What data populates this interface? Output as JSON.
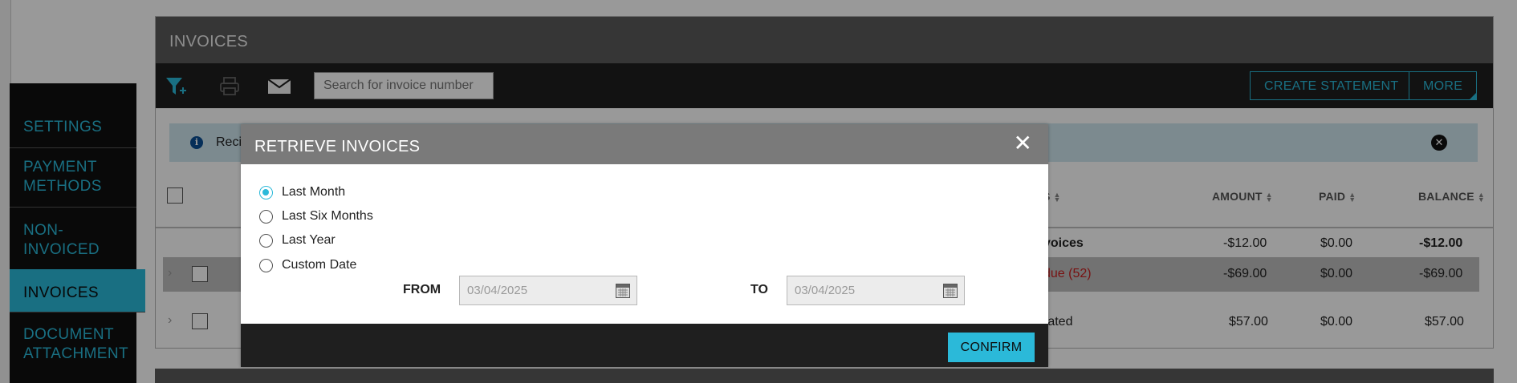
{
  "sidebar": {
    "items": [
      {
        "label": "SETTINGS"
      },
      {
        "label": "PAYMENT METHODS"
      },
      {
        "label": "NON-INVOICED"
      },
      {
        "label": "INVOICES"
      },
      {
        "label": "DOCUMENT ATTACHMENT"
      }
    ]
  },
  "panel": {
    "title": "INVOICES",
    "search_placeholder": "Search for invoice number",
    "create_statement_label": "CREATE STATEMENT",
    "more_label": "MORE",
    "info_text": "Recip"
  },
  "table": {
    "headers": {
      "status": "S",
      "amount": "AMOUNT",
      "paid": "PAID",
      "balance": "BALANCE"
    },
    "rows": [
      {
        "status": "voices",
        "amount": "-$12.00",
        "paid": "$0.00",
        "balance": "-$12.00"
      },
      {
        "status": "due (52)",
        "amount": "-$69.00",
        "paid": "$0.00",
        "balance": "-$69.00"
      },
      {
        "status": "rated",
        "amount": "$57.00",
        "paid": "$0.00",
        "balance": "$57.00"
      }
    ]
  },
  "modal": {
    "title": "RETRIEVE INVOICES",
    "options": [
      {
        "label": "Last Month",
        "selected": true
      },
      {
        "label": "Last Six Months",
        "selected": false
      },
      {
        "label": "Last Year",
        "selected": false
      },
      {
        "label": "Custom Date",
        "selected": false
      }
    ],
    "from_label": "FROM",
    "from_value": "03/04/2025",
    "to_label": "TO",
    "to_value": "03/04/2025",
    "confirm_label": "CONFIRM"
  },
  "colors": {
    "accent": "#2bb9d9",
    "overdue": "#c81e1e"
  },
  "icons": [
    "filter-add-icon",
    "print-icon",
    "mail-icon",
    "info-icon",
    "close-circle-icon",
    "calendar-icon",
    "close-icon"
  ]
}
